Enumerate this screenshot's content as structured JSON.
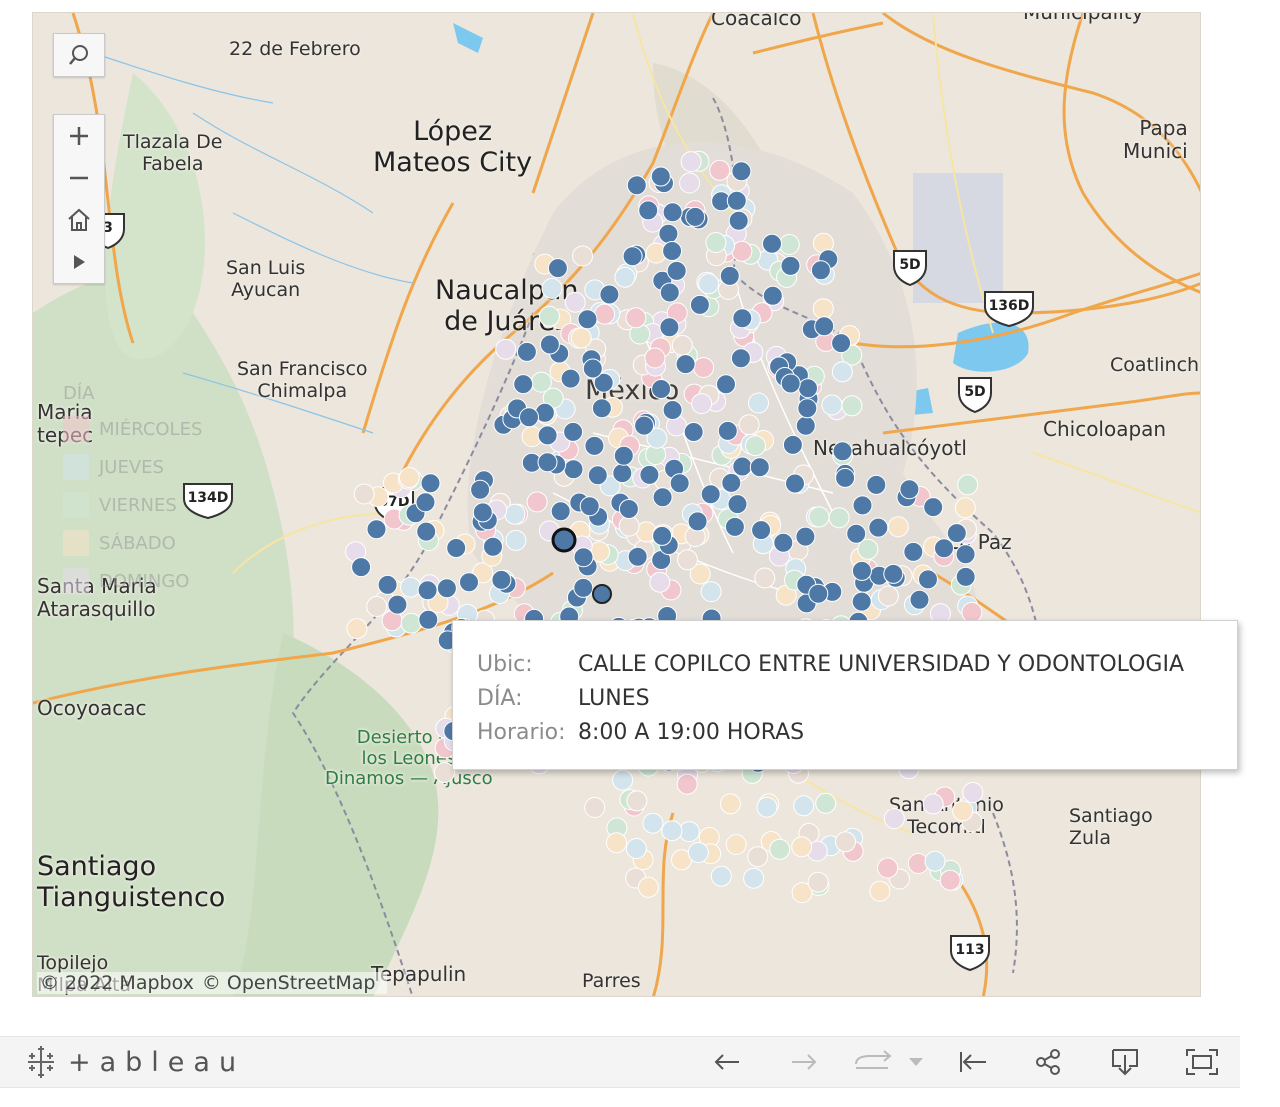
{
  "map": {
    "attribution": [
      "© 2022 Mapbox",
      "© OpenStreetMap"
    ],
    "places": [
      {
        "name": "Coacalco",
        "size": "mid"
      },
      {
        "name": "Municipality",
        "size": "mid"
      },
      {
        "name": "22 de Febrero",
        "size": "sm"
      },
      {
        "name": "López\nMateos City",
        "size": "big"
      },
      {
        "name": "Tlazala De\nFabela",
        "size": "sm"
      },
      {
        "name": "San Luis\nAyucan",
        "size": "sm"
      },
      {
        "name": "Naucalpan\nde Juárez",
        "size": "big"
      },
      {
        "name": "San Francisco\nChimalpa",
        "size": "sm"
      },
      {
        "name": "Maria\ntepec",
        "size": "mid"
      },
      {
        "name": "Papa\nMunici",
        "size": "mid"
      },
      {
        "name": "Coatlinch",
        "size": "sm"
      },
      {
        "name": "Chicoloapan",
        "size": "mid"
      },
      {
        "name": "Nezahualcóyotl",
        "size": "mid"
      },
      {
        "name": "La Paz",
        "size": "mid"
      },
      {
        "name": "Santa Maria\nAtarasquillo",
        "size": "mid"
      },
      {
        "name": "Ocoyoacac",
        "size": "mid"
      },
      {
        "name": "Desierto de\nlos Leones\nDinamos — Ajusco",
        "size": "green"
      },
      {
        "name": "San Antonio\nTecomitl",
        "size": "sm"
      },
      {
        "name": "Santiago Zula",
        "size": "sm"
      },
      {
        "name": "Santiago\nTianguistenco",
        "size": "big"
      },
      {
        "name": "Topilejo\nMilpa Alta",
        "size": "sm"
      },
      {
        "name": "Tepapulin",
        "size": "mid"
      },
      {
        "name": "Parres",
        "size": "sm"
      },
      {
        "name": "México",
        "size": "big"
      }
    ],
    "shields": [
      "3",
      "5D",
      "136D",
      "5D",
      "134D",
      "57D",
      "113"
    ],
    "controls": [
      "search-icon",
      "zoom-in-icon",
      "zoom-out-icon",
      "home-icon",
      "play-icon"
    ]
  },
  "legend": {
    "title": "DÍA",
    "items": [
      {
        "label": "MIÉRCOLES",
        "color": "#f1c6cc"
      },
      {
        "label": "JUEVES",
        "color": "#d4e4ec"
      },
      {
        "label": "VIERNES",
        "color": "#cfe6d4"
      },
      {
        "label": "SÁBADO",
        "color": "#f6e3c8"
      },
      {
        "label": "DOMINGO",
        "color": "#e6dcea"
      }
    ]
  },
  "points": {
    "highlight_color": "#4e79a7",
    "faded_colors": [
      "#f1c6cc",
      "#d4e4ec",
      "#cfe6d4",
      "#f6e3c8",
      "#e6dcea",
      "#eadfd6"
    ]
  },
  "tooltip": {
    "ubic_label": "Ubic:",
    "ubic_value": "CALLE COPILCO ENTRE UNIVERSIDAD Y ODONTOLOGIA",
    "dia_label": "DÍA:",
    "dia_value": "LUNES",
    "horario_label": "Horario:",
    "horario_value": "8:00 A 19:00 HORAS"
  },
  "toolbar": {
    "brand": "+ableau",
    "buttons": [
      "undo-icon",
      "redo-icon",
      "revert-icon",
      "dropdown-icon",
      "reset-icon",
      "share-icon",
      "download-icon",
      "fullscreen-icon"
    ]
  }
}
